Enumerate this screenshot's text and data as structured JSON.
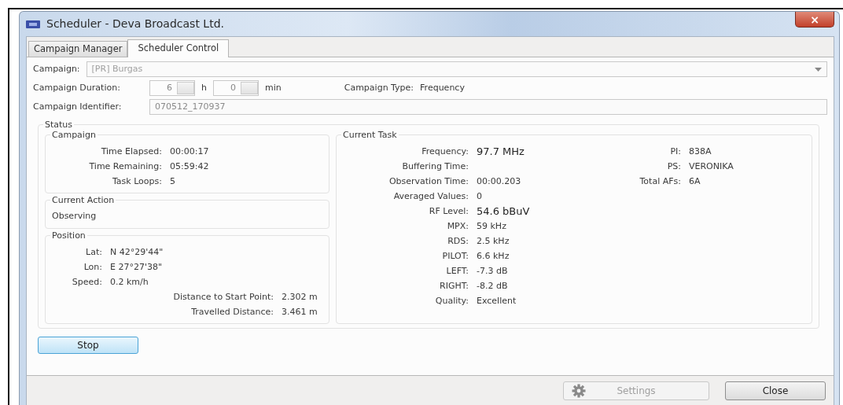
{
  "window": {
    "title": "Scheduler - Deva Broadcast Ltd.",
    "close": "×"
  },
  "tabs": [
    {
      "label": "Campaign Manager",
      "selected": false
    },
    {
      "label": "Scheduler Control",
      "selected": true
    }
  ],
  "campaign": {
    "label": "Campaign:",
    "value": "[PR] Burgas",
    "disabled": true
  },
  "duration": {
    "label": "Campaign Duration:",
    "hours": "6",
    "hours_unit": "h",
    "minutes": "0",
    "minutes_unit": "min"
  },
  "campaign_type": {
    "label": "Campaign Type:",
    "value": "Frequency"
  },
  "identifier": {
    "label": "Campaign Identifier:",
    "value": "070512_170937"
  },
  "status": {
    "title": "Status",
    "campaign": {
      "title": "Campaign",
      "rows": [
        {
          "label": "Time Elapsed:",
          "value": "00:00:17"
        },
        {
          "label": "Time Remaining:",
          "value": "05:59:42"
        },
        {
          "label": "Task Loops:",
          "value": "5"
        }
      ]
    },
    "current_action": {
      "title": "Current Action",
      "value": "Observing"
    },
    "position": {
      "title": "Position",
      "coordinates": [
        {
          "label": "Lat:",
          "value": "N 42°29'44\""
        },
        {
          "label": "Lon:",
          "value": "E 27°27'38\""
        },
        {
          "label": "Speed:",
          "value": "0.2 km/h"
        }
      ],
      "distances": [
        {
          "label": "Distance to Start Point:",
          "value": "2.302 m"
        },
        {
          "label": "Travelled Distance:",
          "value": "3.461 m"
        }
      ]
    },
    "current_task": {
      "title": "Current Task",
      "rows": [
        {
          "label": "Frequency:",
          "value": "97.7 MHz",
          "kind": "reading"
        },
        {
          "label": "Buffering Time:",
          "value": "",
          "kind": "plain"
        },
        {
          "label": "Observation Time:",
          "value": "00:00.203",
          "kind": "plain"
        },
        {
          "label": "Averaged Values:",
          "value": "0",
          "kind": "plain"
        },
        {
          "label": "RF Level:",
          "value": "54.6 bBuV",
          "kind": "reading"
        },
        {
          "label": "MPX:",
          "value": "59 kHz",
          "kind": "plain"
        },
        {
          "label": "RDS:",
          "value": "2.5 kHz",
          "kind": "plain"
        },
        {
          "label": "PILOT:",
          "value": "6.6 kHz",
          "kind": "plain"
        },
        {
          "label": "LEFT:",
          "value": "-7.3 dB",
          "kind": "plain"
        },
        {
          "label": "RIGHT:",
          "value": "-8.2 dB",
          "kind": "plain"
        },
        {
          "label": "Quality:",
          "value": "Excellent",
          "kind": "plain"
        }
      ],
      "rds": [
        {
          "label": "PI:",
          "value": "838A"
        },
        {
          "label": "PS:",
          "value": "VERONIKA"
        },
        {
          "label": "Total AFs:",
          "value": "6A"
        }
      ]
    }
  },
  "stop_button": "Stop",
  "footer_buttons": [
    {
      "label": "Settings",
      "disabled": true,
      "kind": "settings"
    },
    {
      "label": "Close",
      "disabled": false,
      "kind": "plain"
    }
  ]
}
